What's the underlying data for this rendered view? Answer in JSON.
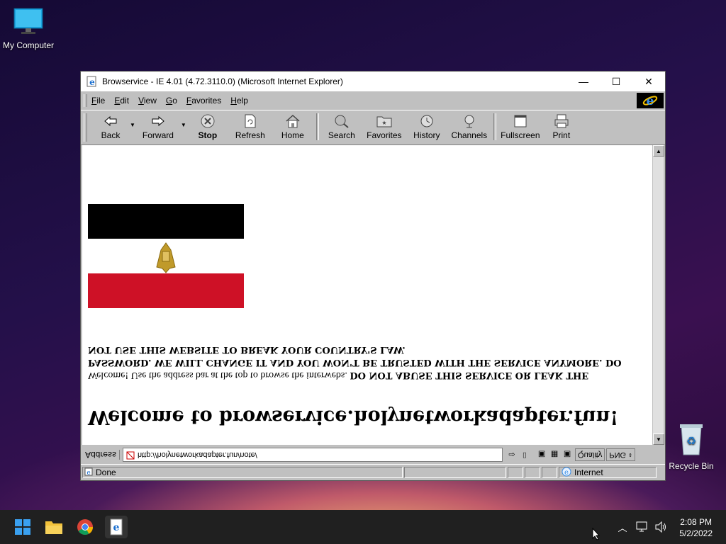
{
  "desktop": {
    "my_computer_label": "My Computer",
    "recycle_bin_label": "Recycle Bin"
  },
  "window": {
    "title": "Browservice - IE 4.01 (4.72.3110.0) (Microsoft Internet Explorer)",
    "menu": [
      "File",
      "Edit",
      "View",
      "Go",
      "Favorites",
      "Help"
    ],
    "toolbar": {
      "back": "Back",
      "forward": "Forward",
      "stop": "Stop",
      "refresh": "Refresh",
      "home": "Home",
      "search": "Search",
      "favorites": "Favorites",
      "history": "History",
      "channels": "Channels",
      "fullscreen": "Fullscreen",
      "print": "Print"
    }
  },
  "page": {
    "heading": "Welcome to browservice.holynetworkadapter.fun!",
    "intro": "Welcome! Use the address bar at the top to browse the interwebs.",
    "warning": "DO NOT ABUSE THIS SERVICE OR LEAK THE PASSWORD. WE WILL CHANGE IT AND YOU WON'T BE TRUSTED WITH THE SERVICE ANYMORE. DO NOT USE THIS WEBSITE TO BREAK YOUR COUNTRY'S LAW."
  },
  "addressbar": {
    "label": "Address",
    "url": "http://holynetworkadapter.fun/note/",
    "quality_label": "Quality",
    "quality_value": "PNG"
  },
  "status": {
    "text": "Done",
    "zone": "Internet"
  },
  "taskbar": {
    "time": "2:08 PM",
    "date": "5/2/2022"
  },
  "colors": {
    "flag_red": "#ce1126",
    "flag_black": "#000000",
    "window_gray": "#c0c0c0"
  }
}
